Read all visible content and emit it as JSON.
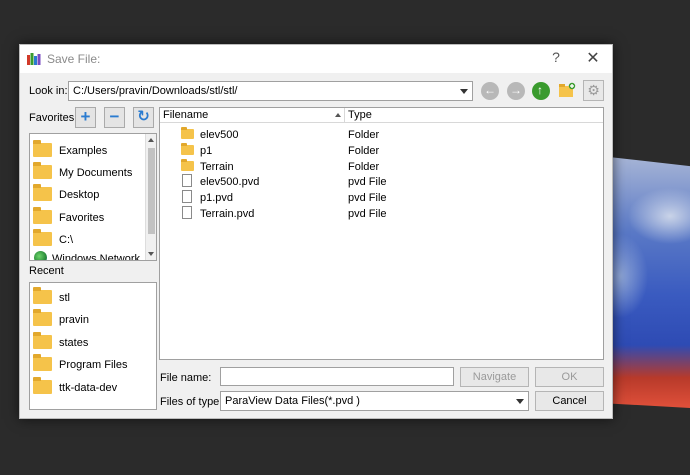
{
  "window": {
    "title": "Save File:",
    "help_glyph": "?",
    "close_glyph": "✕"
  },
  "toolbar": {
    "look_in_label": "Look in:",
    "look_in_path": "C:/Users/pravin/Downloads/stl/stl/",
    "icons": [
      "back-icon",
      "forward-icon",
      "up-folder-icon",
      "new-folder-icon",
      "settings-icon"
    ],
    "settings_glyph": "⚙"
  },
  "favorites": {
    "label": "Favorites",
    "add_glyph": "+",
    "remove_glyph": "−",
    "refresh_glyph": "↻",
    "items": [
      {
        "label": "Examples",
        "icon": "folder-icon"
      },
      {
        "label": "My Documents",
        "icon": "folder-icon"
      },
      {
        "label": "Desktop",
        "icon": "folder-icon"
      },
      {
        "label": "Favorites",
        "icon": "folder-icon"
      },
      {
        "label": "C:\\",
        "icon": "folder-icon"
      },
      {
        "label": "Windows Network",
        "icon": "network-icon"
      }
    ]
  },
  "recent": {
    "label": "Recent",
    "items": [
      {
        "label": "stl"
      },
      {
        "label": "pravin"
      },
      {
        "label": "states"
      },
      {
        "label": "Program Files"
      },
      {
        "label": "ttk-data-dev"
      }
    ]
  },
  "file_list": {
    "columns": {
      "filename": "Filename",
      "type": "Type"
    },
    "rows": [
      {
        "name": "elev500",
        "type": "Folder",
        "icon": "folder-icon"
      },
      {
        "name": "p1",
        "type": "Folder",
        "icon": "folder-icon"
      },
      {
        "name": "Terrain",
        "type": "Folder",
        "icon": "folder-icon"
      },
      {
        "name": "elev500.pvd",
        "type": "pvd File",
        "icon": "file-icon"
      },
      {
        "name": "p1.pvd",
        "type": "pvd File",
        "icon": "file-icon"
      },
      {
        "name": "Terrain.pvd",
        "type": "pvd File",
        "icon": "file-icon"
      }
    ]
  },
  "footer": {
    "file_name_label": "File name:",
    "file_name_value": "",
    "navigate_label": "Navigate",
    "ok_label": "OK",
    "file_type_label": "Files of type:",
    "file_type_value": "ParaView Data Files(*.pvd )",
    "cancel_label": "Cancel"
  },
  "colors": {
    "accent_blue": "#2a7bd0",
    "folder_yellow": "#f5c34a",
    "up_green": "#3a9b2e"
  }
}
